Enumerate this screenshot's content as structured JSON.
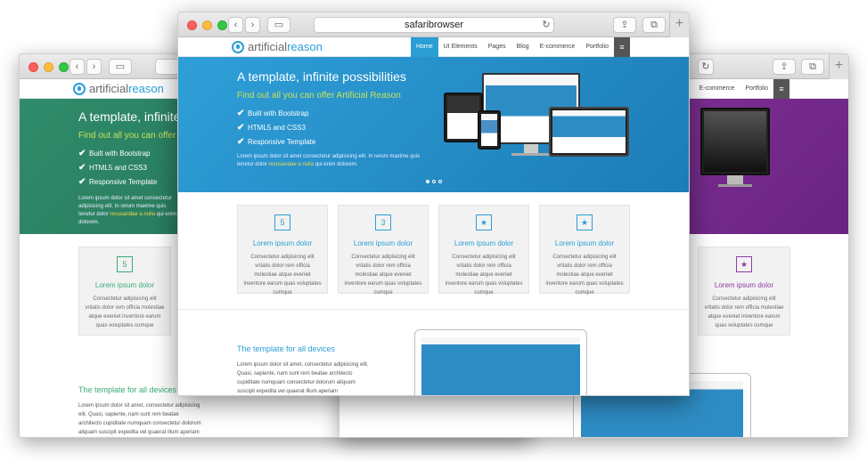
{
  "browser": {
    "address": "safaribrowser",
    "back_glyph": "‹",
    "forward_glyph": "›",
    "sidebar_glyph": "▭",
    "reload_glyph": "↻",
    "share_glyph": "⇪",
    "tabs_glyph": "⧉",
    "plus_glyph": "+"
  },
  "site": {
    "logo_prefix": "artificial",
    "logo_suffix": "reason",
    "nav": [
      "Home",
      "UI Elements",
      "Pages",
      "Blog",
      "E-commerce",
      "Portfolio"
    ],
    "nav_burger": "≡",
    "hero_title": "A template, infinite possibilities",
    "hero_subtitle": "Find out all you can offer Artificial Reason",
    "features": [
      "Built with Bootstrap",
      "HTML5 and CSS3",
      "Responsive Template"
    ],
    "check_glyph": "✔",
    "hero_text_a": "Lorem ipsum dolor sit amet consectetur adipisicing elit. In rerum maxime quis tenetur dolor ",
    "hero_text_link": "recusandae a nulla",
    "hero_text_b": " qui enim dolorem.",
    "cards": [
      {
        "icon": "5",
        "title": "Lorem ipsum dolor",
        "text": "Consectetur adipisicing elit vritatis dolor rem officia molestiae atque eveniet inventore earum quas voluptates cumque"
      },
      {
        "icon": "3",
        "title": "Lorem ipsum dolor",
        "text": "Consectetur adipisicing elit vritatis dolor rem officia molestiae atque eveniet inventore earum quas voluptates cumque"
      },
      {
        "icon": "★",
        "title": "Lorem ipsum dolor",
        "text": "Consectetur adipisicing elit vritatis dolor rem officia molestiae atque eveniet inventore earum quas voluptates cumque"
      },
      {
        "icon": "★",
        "title": "Lorem ipsum dolor",
        "text": "Consectetur adipisicing elit vritatis dolor rem officia molestiae atque eveniet inventore earum quas voluptates cumque"
      }
    ],
    "section_title": "The template for all devices",
    "section_text": "Lorem ipsum dolor sit amet, consectetur adipisicing elit. Quasi, sapiente, nam sunt rem beatae architecto cupiditate numquam consectetur dolorum aliquam suscipit expedita vel quaerat illum aperiam",
    "left_hero_text_a": "Lorem ipsum dolor sit amet consectetur adipisicing elit. In rerum maxime quis tenetur dolor ",
    "left_hero_text_link": "recusandae a nulla",
    "left_hero_text_b": " qui enim dolorem.",
    "left_title_clip": "A template, infinite po",
    "left_subtitle_clip": "Find out all you can offer A",
    "right_nav": [
      "E-commerce",
      "Portfolio"
    ],
    "right_card_title": "Lorem ipsum dolor",
    "right_card_text": "Consectetur adipisicing elit vritatis dolor rem officia molestiae atque eveniet inventore earum quas voluptates cumque"
  },
  "colors": {
    "blue": "#2b9ed6",
    "green": "#2a7f63",
    "purple": "#7a2b8f"
  }
}
